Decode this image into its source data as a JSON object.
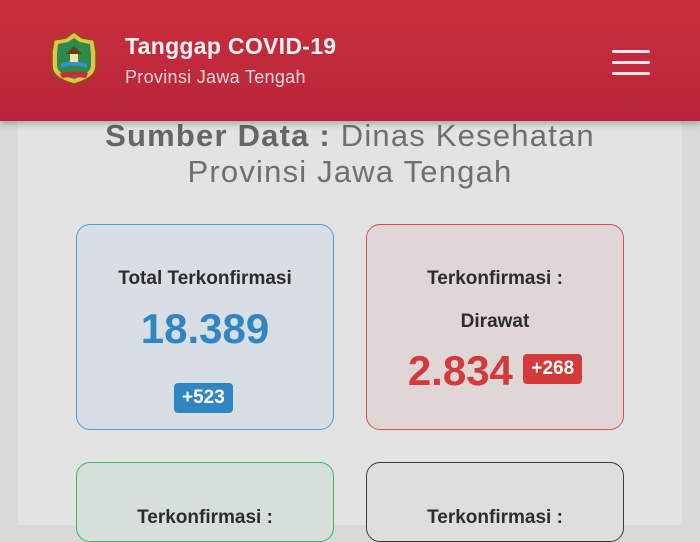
{
  "header": {
    "title": "Tanggap COVID-19",
    "subtitle": "Provinsi Jawa Tengah",
    "logo_icon": "jawa-tengah-emblem-icon",
    "menu_icon": "hamburger-menu-icon"
  },
  "source": {
    "label": "Sumber Data :",
    "line1": "Dinas Kesehatan",
    "line2": "Provinsi Jawa Tengah"
  },
  "cards": [
    {
      "label": "Total Terkonfirmasi",
      "value": "18.389",
      "delta": "+523",
      "color": "#2f86c2"
    },
    {
      "label": "Terkonfirmasi :",
      "sublabel": "Dirawat",
      "value": "2.834",
      "delta": "+268",
      "color": "#d33a3a"
    },
    {
      "label": "Terkonfirmasi :",
      "color": "#3fb46a"
    },
    {
      "label": "Terkonfirmasi :",
      "color": "#3b3b3b"
    }
  ]
}
